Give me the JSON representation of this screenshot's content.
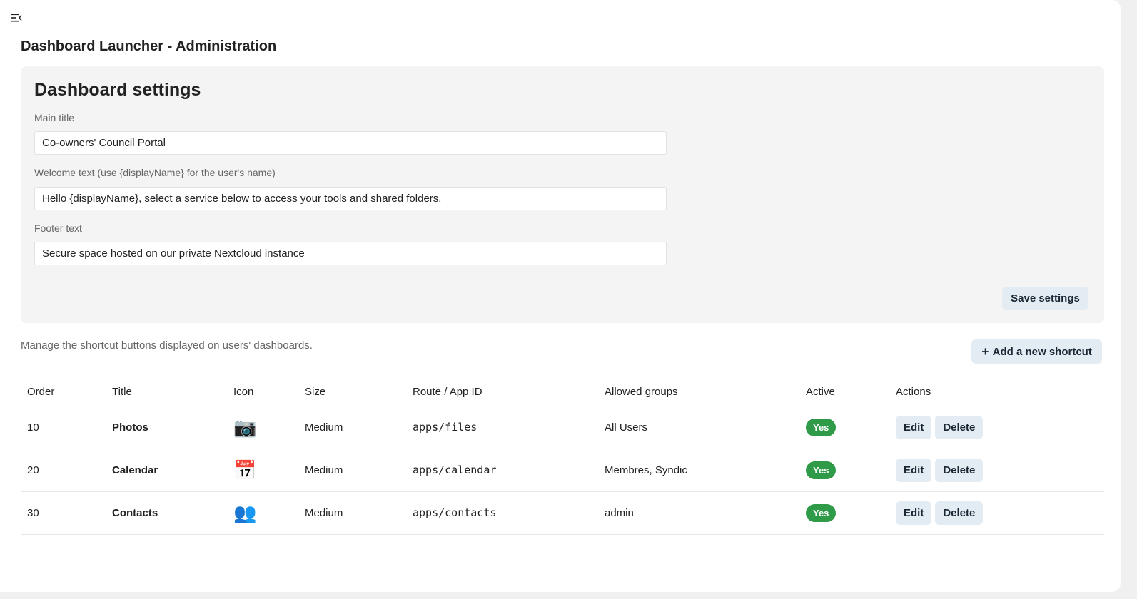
{
  "header": {
    "page_title": "Dashboard Launcher - Administration"
  },
  "settings": {
    "heading": "Dashboard settings",
    "main_title_label": "Main title",
    "main_title_value": "Co-owners' Council Portal",
    "welcome_label": "Welcome text (use {displayName} for the user's name)",
    "welcome_value": "Hello {displayName}, select a service below to access your tools and shared folders.",
    "footer_label": "Footer text",
    "footer_value": "Secure space hosted on our private Nextcloud instance",
    "save_label": "Save settings"
  },
  "shortcuts": {
    "description": "Manage the shortcut buttons displayed on users' dashboards.",
    "add_label": "Add a new shortcut",
    "columns": [
      "Order",
      "Title",
      "Icon",
      "Size",
      "Route / App ID",
      "Allowed groups",
      "Active",
      "Actions"
    ],
    "edit_label": "Edit",
    "delete_label": "Delete",
    "rows": [
      {
        "order": "10",
        "title": "Photos",
        "icon": "📷",
        "size": "Medium",
        "route": "apps/files",
        "groups": "All Users",
        "active": "Yes"
      },
      {
        "order": "20",
        "title": "Calendar",
        "icon": "📅",
        "size": "Medium",
        "route": "apps/calendar",
        "groups": "Membres, Syndic",
        "active": "Yes"
      },
      {
        "order": "30",
        "title": "Contacts",
        "icon": "👥",
        "size": "Medium",
        "route": "apps/contacts",
        "groups": "admin",
        "active": "Yes"
      }
    ]
  },
  "colors": {
    "active_badge": "#2f9a48",
    "button_bg": "#e3ecf3",
    "card_bg": "#f4f4f4"
  }
}
